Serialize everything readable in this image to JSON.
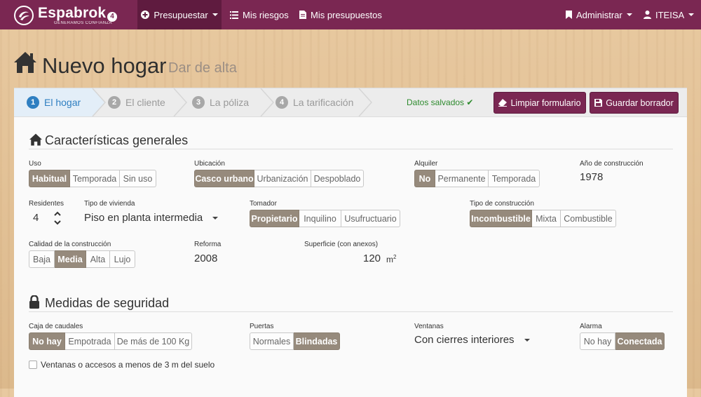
{
  "navbar": {
    "brand": "Espabrok",
    "tagline": "GENERAMOS CONFIANZA",
    "badge": "4",
    "items": [
      {
        "label": "Presupuestar"
      },
      {
        "label": "Mis riesgos"
      },
      {
        "label": "Mis presupuestos"
      }
    ],
    "admin_label": "Administrar",
    "user_label": "ITEISA"
  },
  "page": {
    "title": "Nuevo hogar",
    "subtitle": "Dar de alta"
  },
  "wizard": {
    "steps": [
      {
        "num": "1",
        "label": "El hogar"
      },
      {
        "num": "2",
        "label": "El cliente"
      },
      {
        "num": "3",
        "label": "La póliza"
      },
      {
        "num": "4",
        "label": "La tarificación"
      }
    ],
    "saved_status": "Datos salvados ✔",
    "clear_label": "Limpiar formulario",
    "save_draft_label": "Guardar borrador"
  },
  "general": {
    "title": "Características generales",
    "uso": {
      "label": "Uso",
      "options": [
        "Habitual",
        "Temporada",
        "Sin uso"
      ],
      "selected": "Habitual"
    },
    "ubicacion": {
      "label": "Ubicación",
      "options": [
        "Casco urbano",
        "Urbanización",
        "Despoblado"
      ],
      "selected": "Casco urbano"
    },
    "alquiler": {
      "label": "Alquiler",
      "options": [
        "No",
        "Permanente",
        "Temporada"
      ],
      "selected": "No"
    },
    "anio": {
      "label": "Año de construcción",
      "value": "1978"
    },
    "residentes": {
      "label": "Residentes",
      "value": "4"
    },
    "tipo_vivienda": {
      "label": "Tipo de vivienda",
      "value": "Piso en planta intermedia"
    },
    "tomador": {
      "label": "Tomador",
      "options": [
        "Propietario",
        "Inquilino",
        "Usufructuario"
      ],
      "selected": "Propietario"
    },
    "tipo_construccion": {
      "label": "Tipo de construcción",
      "options": [
        "Incombustible",
        "Mixta",
        "Combustible"
      ],
      "selected": "Incombustible"
    },
    "calidad": {
      "label": "Calidad de la construcción",
      "options": [
        "Baja",
        "Media",
        "Alta",
        "Lujo"
      ],
      "selected": "Media"
    },
    "reforma": {
      "label": "Reforma",
      "value": "2008"
    },
    "superficie": {
      "label": "Superficie (con anexos)",
      "value": "120",
      "unit": "m",
      "unit_sup": "2"
    }
  },
  "security": {
    "title": "Medidas de seguridad",
    "caja": {
      "label": "Caja de caudales",
      "options": [
        "No hay",
        "Empotrada",
        "De más de 100 Kg"
      ],
      "selected": "No hay"
    },
    "puertas": {
      "label": "Puertas",
      "options": [
        "Normales",
        "Blindadas"
      ],
      "selected": "Blindadas"
    },
    "ventanas": {
      "label": "Ventanas",
      "value": "Con cierres interiores"
    },
    "alarma": {
      "label": "Alarma",
      "options": [
        "No hay",
        "Conectada"
      ],
      "selected": "Conectada"
    },
    "checkbox_label": "Ventanas o accesos a menos de 3 m del suelo"
  },
  "colors": {
    "brand": "#7a2752",
    "brand_dark": "#5f1b3f",
    "active_step": "#2f7fc1",
    "selected_option": "#968a7c",
    "saved_green": "#2e8b2e"
  }
}
